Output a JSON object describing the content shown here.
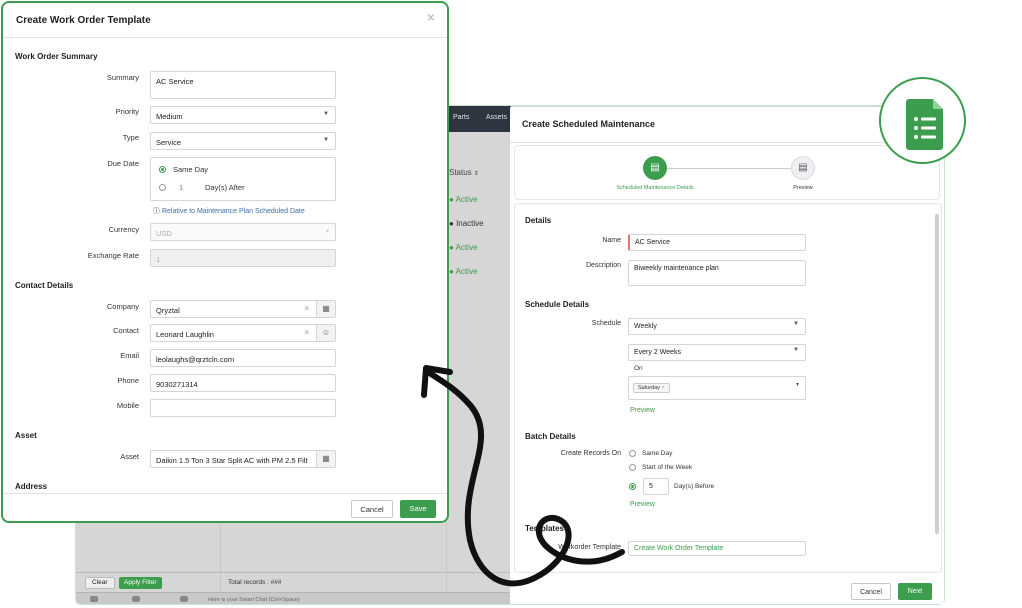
{
  "background_app": {
    "nav_parts": "Parts",
    "nav_assets": "Assets",
    "status_header": "Status",
    "statuses": [
      {
        "label": "Active",
        "color": "#3c9d4e"
      },
      {
        "label": "Inactive",
        "color": "#333333"
      },
      {
        "label": "Active",
        "color": "#3c9d4e"
      },
      {
        "label": "Active",
        "color": "#3c9d4e"
      }
    ],
    "clear_label": "Clear",
    "apply_filter_label": "Apply Filter",
    "total_records": "Total records : ###",
    "chat_placeholder": "Here is your Smart Chat (Ctrl+Space)"
  },
  "scheduled_maintenance": {
    "title": "Create Scheduled Maintenance",
    "steps": [
      {
        "label": "Scheduled Maintenance Details",
        "active": true,
        "icon": "document-icon"
      },
      {
        "label": "Preview",
        "active": false,
        "icon": "preview-icon"
      }
    ],
    "details_title": "Details",
    "name_label": "Name",
    "name_value": "AC Service",
    "description_label": "Description",
    "description_value": "Biweekly maintenance plan",
    "schedule_details_title": "Schedule Details",
    "schedule_label": "Schedule",
    "schedule_value": "Weekly",
    "frequency_value": "Every 2 Weeks",
    "on_label": "On",
    "on_chip": "Saturday",
    "preview_link": "Preview",
    "batch_details_title": "Batch Details",
    "create_records_label": "Create Records On",
    "options": [
      "Same Day",
      "Start of the Week"
    ],
    "days_before_value": "5",
    "days_before_label": "Day(s) Before",
    "preview_link2": "Preview",
    "templates_title": "Templates",
    "workorder_template_label": "Workorder Template",
    "workorder_template_value": "Create Work Order Template",
    "cancel_label": "Cancel",
    "next_label": "Next"
  },
  "work_order_template": {
    "title": "Create Work Order Template",
    "close_icon": "close-icon",
    "summary_section": "Work Order Summary",
    "summary_label": "Summary",
    "summary_value": "AC Service",
    "priority_label": "Priority",
    "priority_value": "Medium",
    "type_label": "Type",
    "type_value": "Service",
    "due_date_label": "Due Date",
    "same_day_label": "Same Day",
    "days_value": "1",
    "days_after_label": "Day(s) After",
    "relative_note": "Relative to Maintenance Plan Scheduled Date",
    "currency_label": "Currency",
    "currency_value": "USD",
    "exchange_rate_label": "Exchange Rate",
    "exchange_rate_value": "1",
    "contact_section": "Contact Details",
    "company_label": "Company",
    "company_value": "Qryztal",
    "contact_label": "Contact",
    "contact_value": "Leonard Laughlin",
    "email_label": "Email",
    "email_value": "leolaughs@qrztcln.com",
    "phone_label": "Phone",
    "phone_value": "9030271314",
    "mobile_label": "Mobile",
    "mobile_value": "",
    "asset_section": "Asset",
    "asset_label": "Asset",
    "asset_value": "Daikin 1.5 Ton 3 Star Split AC with PM 2.5 Filt",
    "address_section": "Address",
    "cancel_label": "Cancel",
    "save_label": "Save"
  },
  "colors": {
    "accent_green": "#3c9d4e",
    "required_red": "#e57373"
  }
}
